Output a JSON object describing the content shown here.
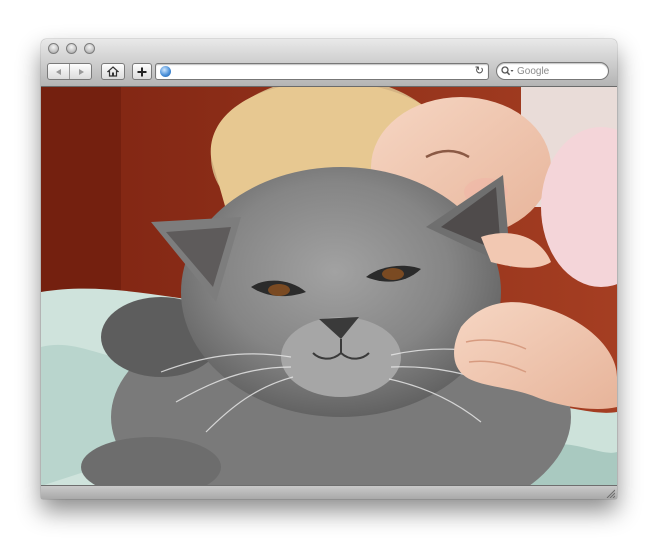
{
  "window": {
    "search_placeholder": "Google",
    "icons": [
      "close-dot-icon",
      "minimize-dot-icon",
      "zoom-dot-icon",
      "back-arrow-icon",
      "forward-arrow-icon",
      "home-icon",
      "add-bookmark-icon",
      "globe-icon",
      "reload-icon",
      "search-magnifier-icon",
      "resize-grip-icon"
    ]
  },
  "content": {
    "image_subject": "photo"
  },
  "colors": {
    "toolbar_top": "#e9e9e9",
    "toolbar_bottom": "#b4b4b4",
    "wall": "#8b2a17",
    "cat_fur": "#8a8a8a",
    "blanket": "#cfe3dc"
  }
}
